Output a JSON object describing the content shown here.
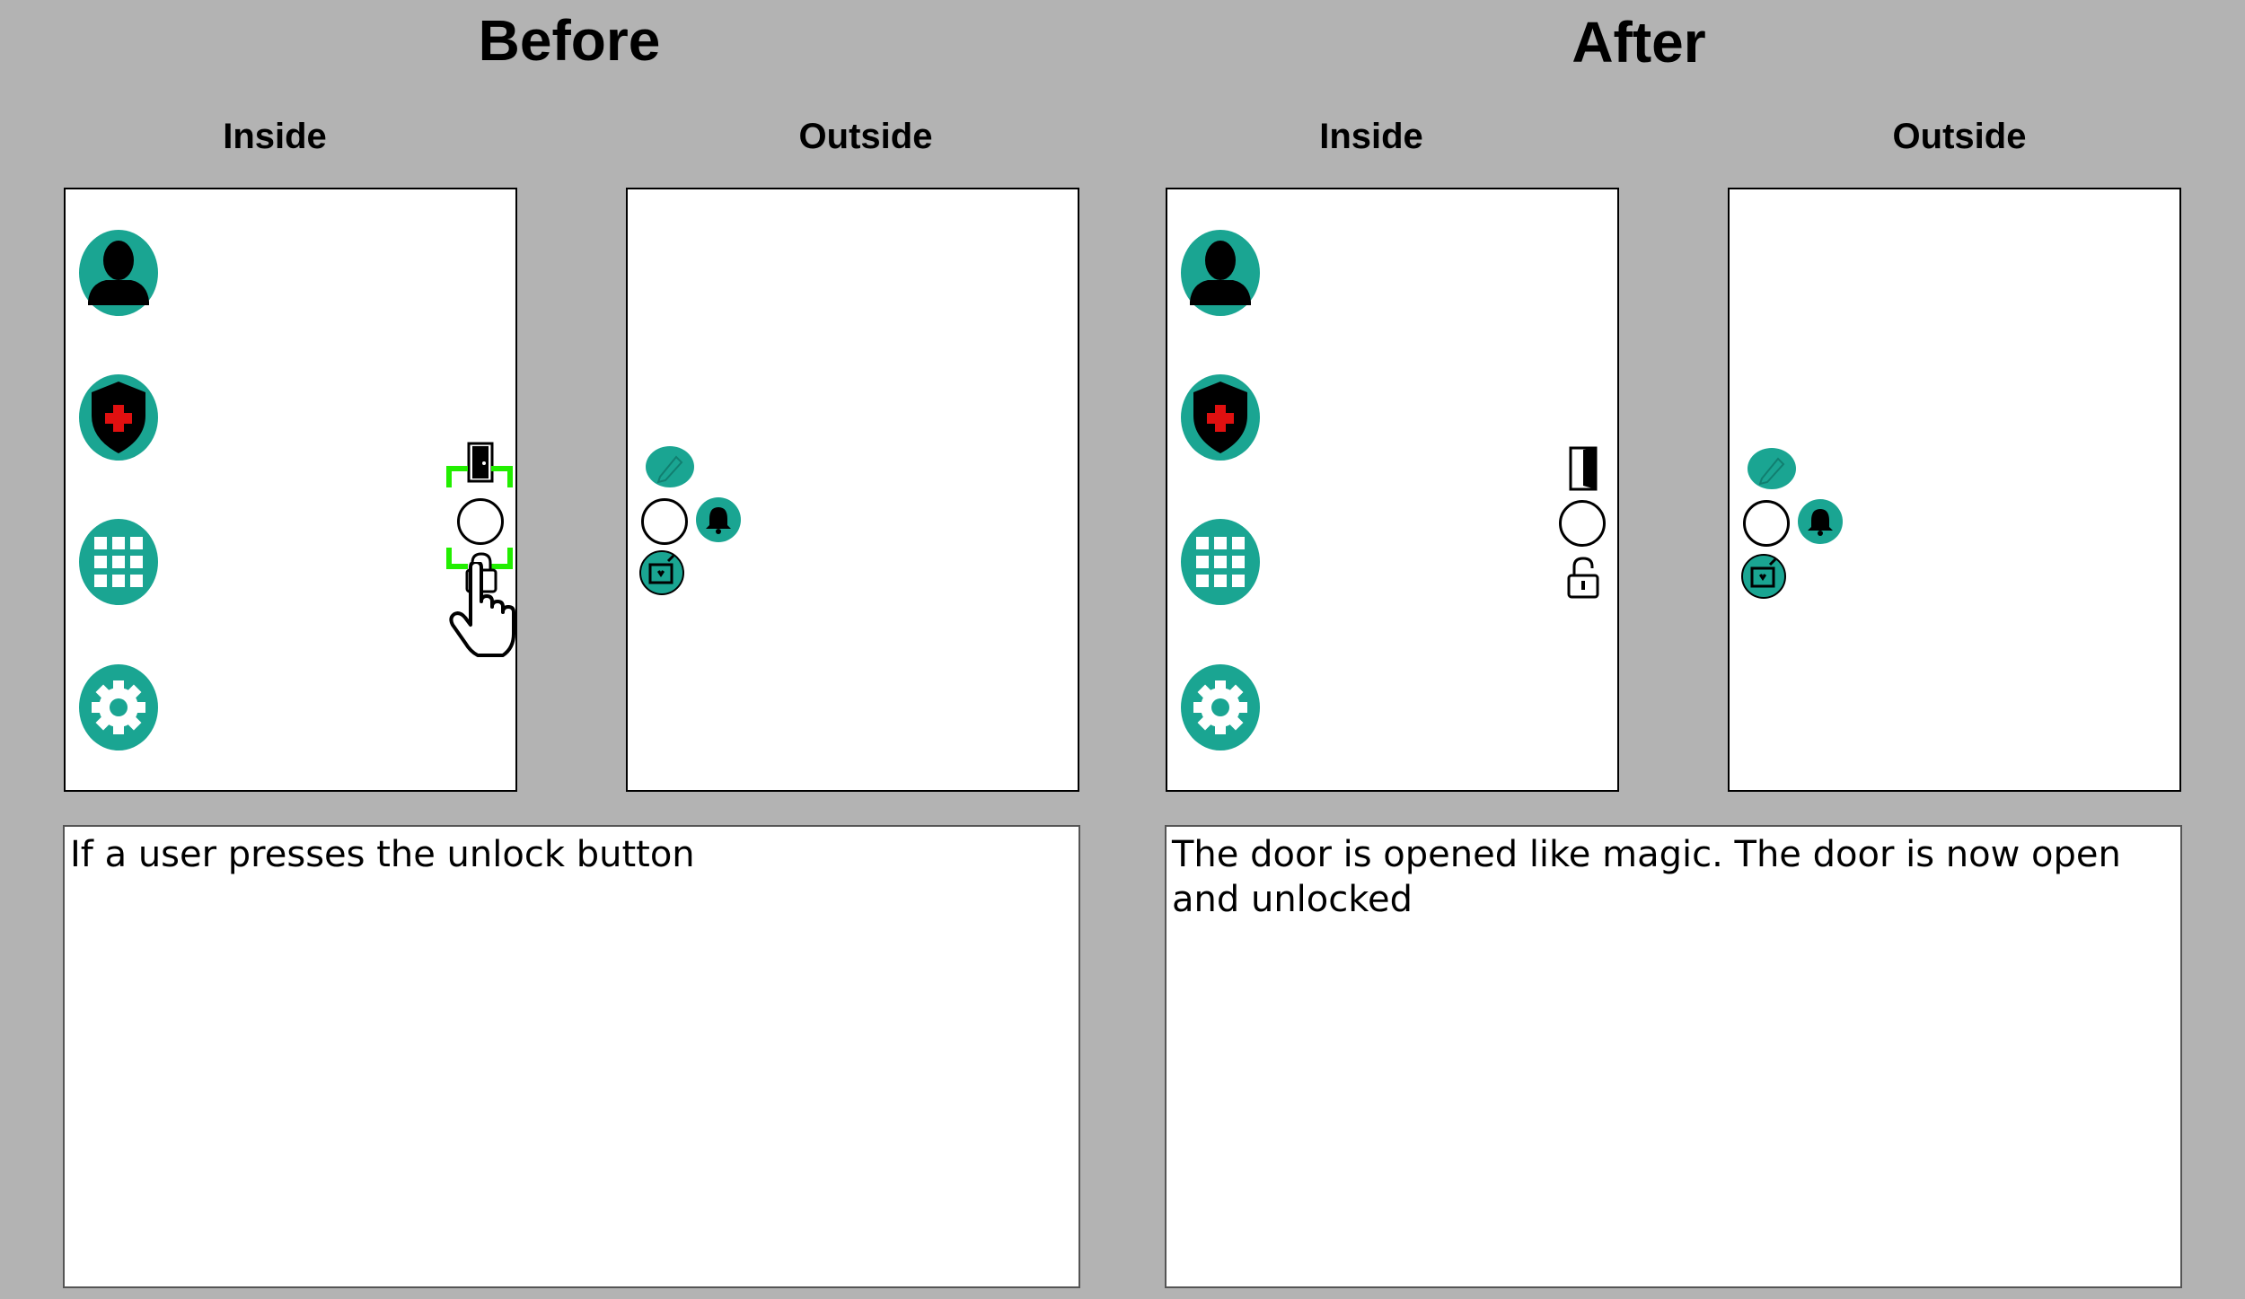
{
  "colors": {
    "accent": "#1aa592",
    "background": "#b3b3b3",
    "highlight": "#22ee00",
    "shield_cross": "#e01010"
  },
  "before": {
    "heading": "Before",
    "inside_label": "Inside",
    "outside_label": "Outside",
    "description": "If a user presses the unlock button"
  },
  "after": {
    "heading": "After",
    "inside_label": "Inside",
    "outside_label": "Outside",
    "description": "The door is opened like magic. The door is now open and unlocked"
  },
  "icons": {
    "sidebar": [
      "user-icon",
      "shield-medical-icon",
      "keypad-icon",
      "settings-icon"
    ],
    "door_controls": [
      "door-icon",
      "circle-button-icon",
      "padlock-icon"
    ],
    "outside_controls": [
      "pen-icon",
      "doorbell-button",
      "bell-icon",
      "message-icon"
    ],
    "pointer": "hand-pointer-icon"
  }
}
